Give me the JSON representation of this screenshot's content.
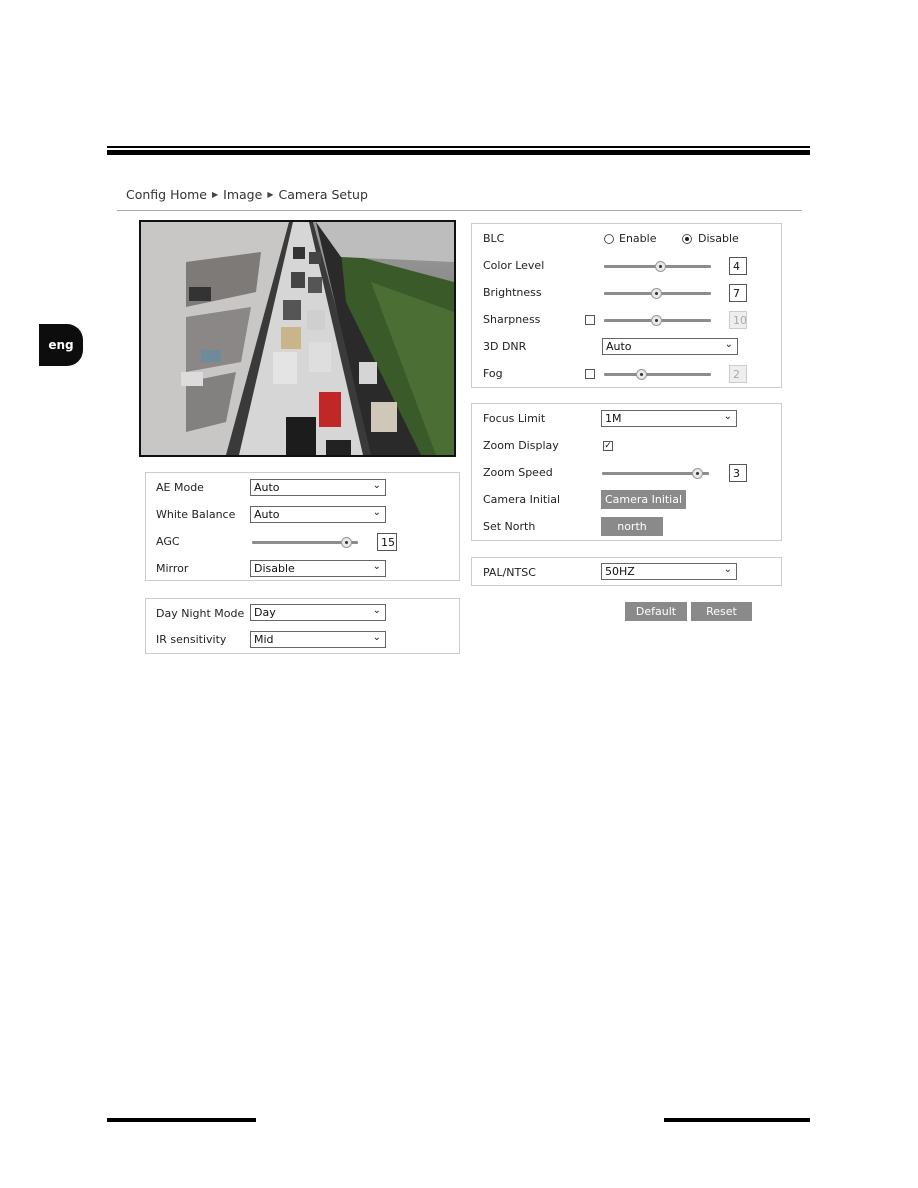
{
  "language_tab": "eng",
  "breadcrumb": {
    "items": [
      "Config Home",
      "Image",
      "Camera Setup"
    ],
    "separator_icon": "triangle-right-icon"
  },
  "video_preview": {
    "description": "Live camera view of traffic on a road between parking structures"
  },
  "right_panel_image": {
    "blc": {
      "label": "BLC",
      "options": [
        "Enable",
        "Disable"
      ],
      "selected": "Disable"
    },
    "color_level": {
      "label": "Color Level",
      "value": "4",
      "slider_fraction": 0.53
    },
    "brightness": {
      "label": "Brightness",
      "value": "7",
      "slider_fraction": 0.49
    },
    "sharpness": {
      "label": "Sharpness",
      "value": "10",
      "enabled": false,
      "slider_fraction": 0.49
    },
    "dnr": {
      "label": "3D DNR",
      "value": "Auto"
    },
    "fog": {
      "label": "Fog",
      "value": "2",
      "enabled": false,
      "slider_fraction": 0.33
    }
  },
  "right_panel_focus": {
    "focus_limit": {
      "label": "Focus Limit",
      "value": "1M"
    },
    "zoom_display": {
      "label": "Zoom Display",
      "checked": true
    },
    "zoom_speed": {
      "label": "Zoom Speed",
      "value": "3",
      "slider_fraction": 0.94
    },
    "camera_initial": {
      "label": "Camera Initial",
      "button": "Camera Initial"
    },
    "set_north": {
      "label": "Set North",
      "button": "north"
    }
  },
  "right_panel_video": {
    "pal_ntsc": {
      "label": "PAL/NTSC",
      "value": "50HZ"
    }
  },
  "actions": {
    "default": "Default",
    "reset": "Reset"
  },
  "left_panel_exposure": {
    "ae_mode": {
      "label": "AE Mode",
      "value": "Auto"
    },
    "white_balance": {
      "label": "White Balance",
      "value": "Auto"
    },
    "agc": {
      "label": "AGC",
      "value": "15",
      "slider_fraction": 0.94
    },
    "mirror": {
      "label": "Mirror",
      "value": "Disable"
    }
  },
  "left_panel_daynight": {
    "day_night_mode": {
      "label": "Day Night Mode",
      "value": "Day"
    },
    "ir_sensitivity": {
      "label": "IR sensitivity",
      "value": "Mid"
    }
  },
  "colors": {
    "button_gray": "#8a8a8a",
    "border": "#cccccc"
  }
}
